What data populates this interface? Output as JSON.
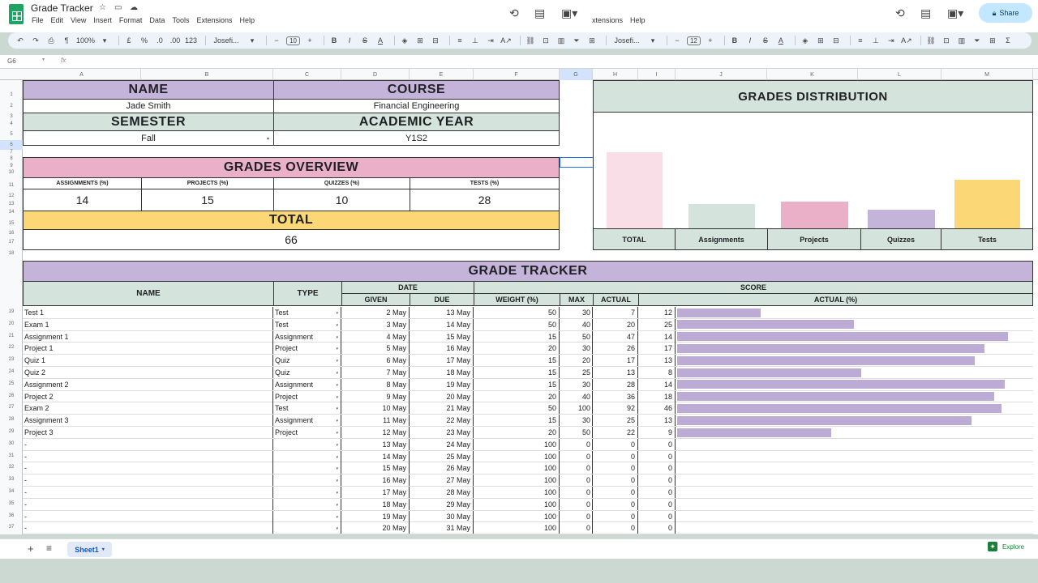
{
  "app": {
    "title": "Grade Tracker",
    "menu": [
      "File",
      "Edit",
      "View",
      "Insert",
      "Format",
      "Data",
      "Tools",
      "Extensions",
      "Help"
    ],
    "menu_overlay": [
      "xtensions",
      "Help"
    ],
    "share_label": "Share"
  },
  "toolbar": {
    "zoom": "100%",
    "currency": "£",
    "percent": "%",
    "dec_less": ".0",
    "dec_more": ".00",
    "format_123": "123",
    "font": "Josefi...",
    "font_size": "10",
    "font2": "Josefi...",
    "font_size2": "12",
    "sigma": "Σ"
  },
  "formula": {
    "cell_ref": "G6",
    "fx": "fx"
  },
  "columns": [
    "A",
    "B",
    "C",
    "D",
    "E",
    "F",
    "G",
    "H",
    "I",
    "J",
    "K",
    "L",
    "M"
  ],
  "rows": [
    "1",
    "2",
    "3",
    "4",
    "5",
    "6",
    "7",
    "8",
    "9",
    "10",
    "11",
    "12",
    "13",
    "14",
    "15",
    "16",
    "17",
    "18",
    "19",
    "20",
    "21",
    "22",
    "23",
    "24",
    "25",
    "26",
    "27",
    "28",
    "29",
    "30",
    "31",
    "32",
    "33",
    "34",
    "35",
    "36",
    "37"
  ],
  "info": {
    "name_label": "NAME",
    "name_value": "Jade Smith",
    "course_label": "COURSE",
    "course_value": "Financial Engineering",
    "semester_label": "SEMESTER",
    "semester_value": "Fall",
    "year_label": "ACADEMIC YEAR",
    "year_value": "Y1S2"
  },
  "overview": {
    "title": "GRADES OVERVIEW",
    "headers": [
      "ASSIGNMENTS (%)",
      "PROJECTS (%)",
      "QUIZZES (%)",
      "TESTS (%)"
    ],
    "values": [
      "14",
      "15",
      "10",
      "28"
    ],
    "total_label": "TOTAL",
    "total_value": "66"
  },
  "chart_data": {
    "type": "bar",
    "title": "GRADES DISTRIBUTION",
    "categories": [
      "TOTAL",
      "Assignments",
      "Projects",
      "Quizzes",
      "Tests"
    ],
    "values": [
      66,
      21,
      23,
      16,
      42
    ],
    "ylim": [
      0,
      100
    ],
    "colors": [
      "#f9dee7",
      "#d4e3dc",
      "#eab0c8",
      "#c4b4d9",
      "#fbd775"
    ]
  },
  "tracker": {
    "title": "GRADE TRACKER",
    "h_name": "NAME",
    "h_type": "TYPE",
    "h_date": "DATE",
    "h_score": "SCORE",
    "h_given": "GIVEN",
    "h_due": "DUE",
    "h_weight": "WEIGHT (%)",
    "h_max": "MAX",
    "h_actual": "ACTUAL",
    "h_actual_pct": "ACTUAL (%)",
    "rows": [
      {
        "name": "Test 1",
        "type": "Test",
        "given": "2 May",
        "due": "13 May",
        "weight": "50",
        "max": "30",
        "actual": "7",
        "pct": "12"
      },
      {
        "name": "Exam 1",
        "type": "Test",
        "given": "3 May",
        "due": "14 May",
        "weight": "50",
        "max": "40",
        "actual": "20",
        "pct": "25"
      },
      {
        "name": "Assignment 1",
        "type": "Assignment",
        "given": "4 May",
        "due": "15 May",
        "weight": "15",
        "max": "50",
        "actual": "47",
        "pct": "14"
      },
      {
        "name": "Project 1",
        "type": "Project",
        "given": "5 May",
        "due": "16 May",
        "weight": "20",
        "max": "30",
        "actual": "26",
        "pct": "17"
      },
      {
        "name": "Quiz 1",
        "type": "Quiz",
        "given": "6 May",
        "due": "17 May",
        "weight": "15",
        "max": "20",
        "actual": "17",
        "pct": "13"
      },
      {
        "name": "Quiz 2",
        "type": "Quiz",
        "given": "7 May",
        "due": "18 May",
        "weight": "15",
        "max": "25",
        "actual": "13",
        "pct": "8"
      },
      {
        "name": "Assignment 2",
        "type": "Assignment",
        "given": "8 May",
        "due": "19 May",
        "weight": "15",
        "max": "30",
        "actual": "28",
        "pct": "14"
      },
      {
        "name": "Project 2",
        "type": "Project",
        "given": "9 May",
        "due": "20 May",
        "weight": "20",
        "max": "40",
        "actual": "36",
        "pct": "18"
      },
      {
        "name": "Exam 2",
        "type": "Test",
        "given": "10 May",
        "due": "21 May",
        "weight": "50",
        "max": "100",
        "actual": "92",
        "pct": "46"
      },
      {
        "name": "Assignment 3",
        "type": "Assignment",
        "given": "11 May",
        "due": "22 May",
        "weight": "15",
        "max": "30",
        "actual": "25",
        "pct": "13"
      },
      {
        "name": "Project 3",
        "type": "Project",
        "given": "12 May",
        "due": "23 May",
        "weight": "20",
        "max": "50",
        "actual": "22",
        "pct": "9"
      },
      {
        "name": "-",
        "type": "",
        "given": "13 May",
        "due": "24 May",
        "weight": "100",
        "max": "0",
        "actual": "0",
        "pct": "0"
      },
      {
        "name": "-",
        "type": "",
        "given": "14 May",
        "due": "25 May",
        "weight": "100",
        "max": "0",
        "actual": "0",
        "pct": "0"
      },
      {
        "name": "-",
        "type": "",
        "given": "15 May",
        "due": "26 May",
        "weight": "100",
        "max": "0",
        "actual": "0",
        "pct": "0"
      },
      {
        "name": "-",
        "type": "",
        "given": "16 May",
        "due": "27 May",
        "weight": "100",
        "max": "0",
        "actual": "0",
        "pct": "0"
      },
      {
        "name": "-",
        "type": "",
        "given": "17 May",
        "due": "28 May",
        "weight": "100",
        "max": "0",
        "actual": "0",
        "pct": "0"
      },
      {
        "name": "-",
        "type": "",
        "given": "18 May",
        "due": "29 May",
        "weight": "100",
        "max": "0",
        "actual": "0",
        "pct": "0"
      },
      {
        "name": "-",
        "type": "",
        "given": "19 May",
        "due": "30 May",
        "weight": "100",
        "max": "0",
        "actual": "0",
        "pct": "0"
      },
      {
        "name": "-",
        "type": "",
        "given": "20 May",
        "due": "31 May",
        "weight": "100",
        "max": "0",
        "actual": "0",
        "pct": "0"
      }
    ],
    "bar_fraction": [
      0.25,
      0.53,
      0.99,
      0.92,
      0.89,
      0.55,
      0.98,
      0.95,
      0.97,
      0.88,
      0.46,
      0,
      0,
      0,
      0,
      0,
      0,
      0,
      0
    ]
  },
  "bottom": {
    "sheet_tab": "Sheet1",
    "explore": "Explore"
  }
}
